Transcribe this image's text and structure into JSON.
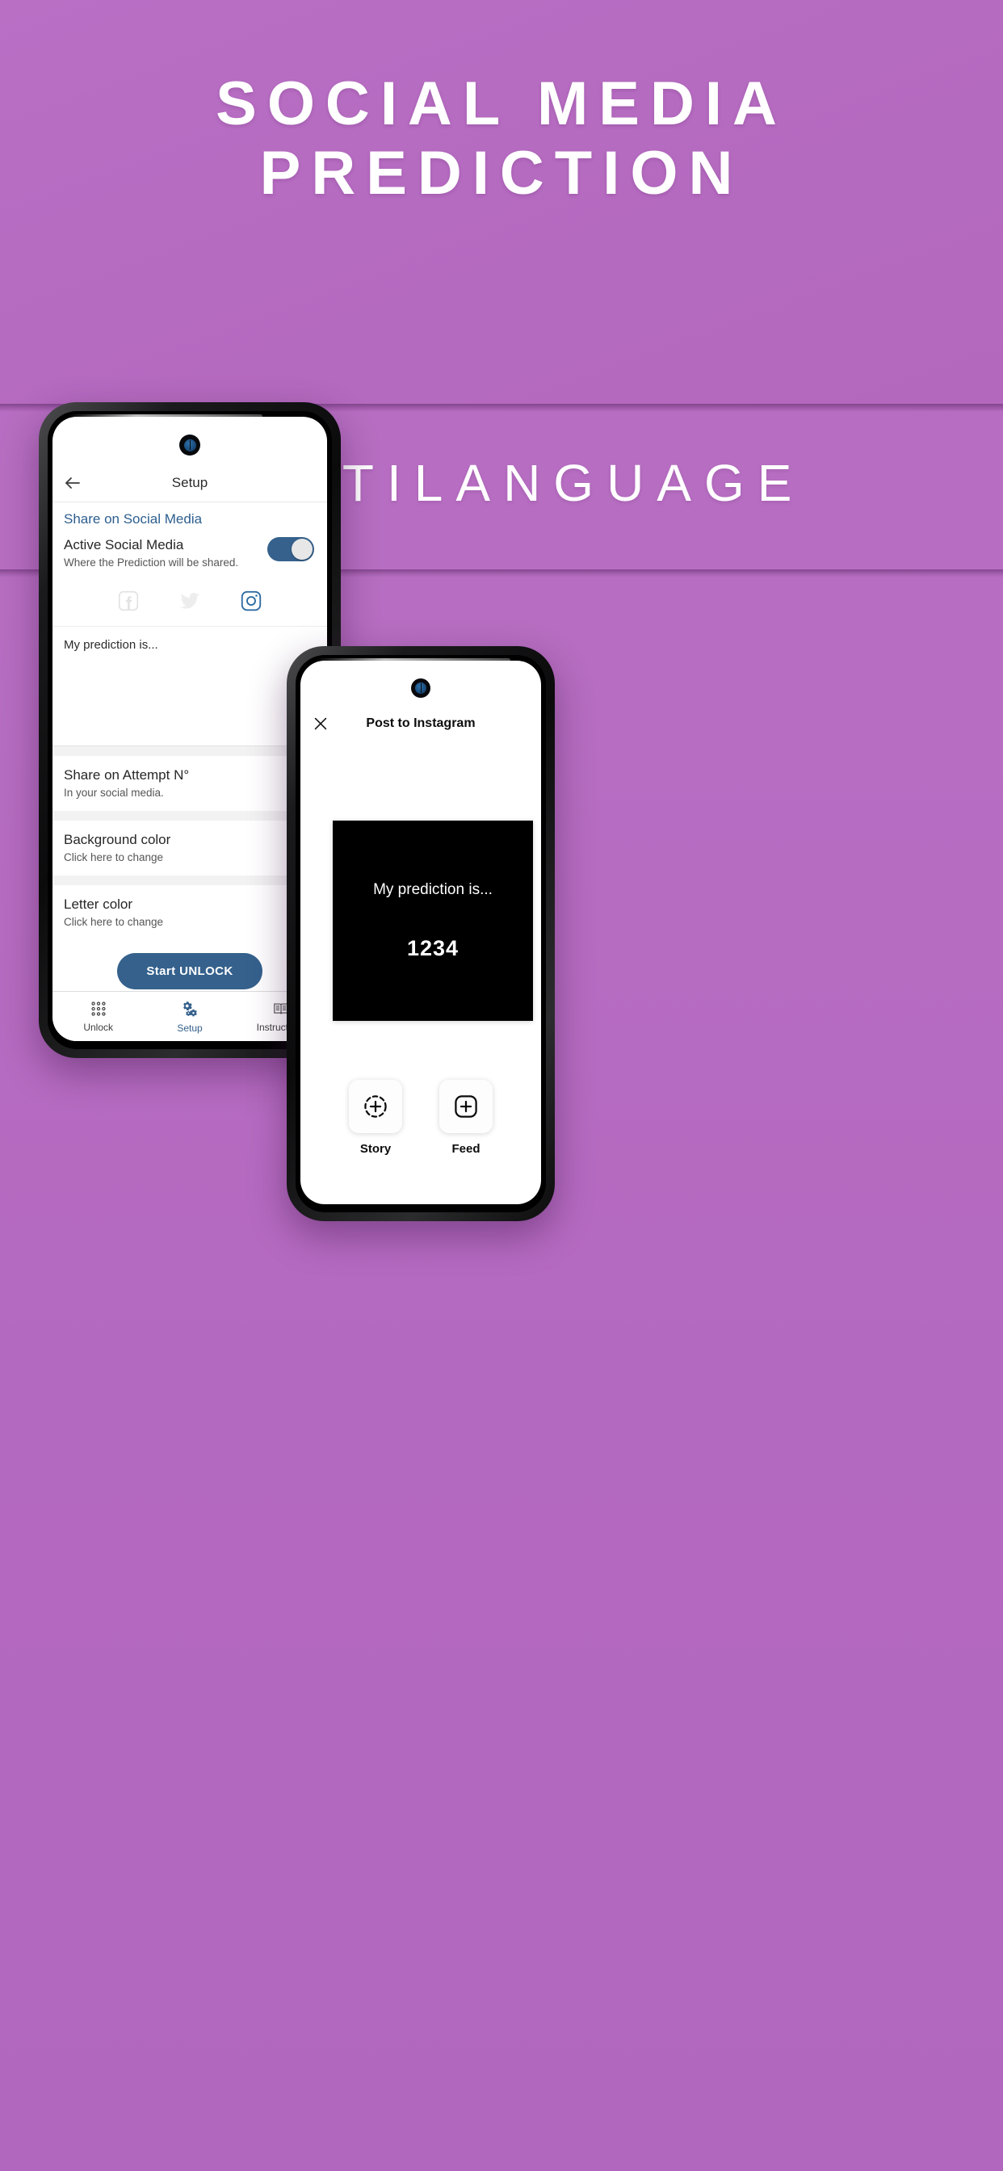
{
  "promo": {
    "headline_line1": "SOCIAL MEDIA",
    "headline_line2": "PREDICTION",
    "subtitle": "MULTILANGUAGE",
    "background_color": "#b66cc0",
    "accent_color": "#35618c"
  },
  "phone1": {
    "appbar": {
      "back_icon": "arrow-left-icon",
      "title": "Setup"
    },
    "section_header": "Share on Social Media",
    "active_row": {
      "title": "Active Social Media",
      "subtitle": "Where the Prediction will be shared.",
      "toggle_state": "on"
    },
    "social_icons": [
      {
        "name": "facebook-icon",
        "label": "Facebook",
        "selected": false
      },
      {
        "name": "twitter-icon",
        "label": "Twitter",
        "selected": false
      },
      {
        "name": "instagram-icon",
        "label": "Instagram",
        "selected": true
      }
    ],
    "prediction_text": "My prediction is...",
    "settings": [
      {
        "title": "Share on Attempt N°",
        "subtitle": "In your social media."
      },
      {
        "title": "Background color",
        "subtitle": "Click here to change"
      },
      {
        "title": "Letter color",
        "subtitle": "Click here to change"
      }
    ],
    "cta_label": "Start UNLOCK",
    "tabs": [
      {
        "label": "Unlock",
        "icon": "grid-dots-icon",
        "active": false
      },
      {
        "label": "Setup",
        "icon": "gears-icon",
        "active": true
      },
      {
        "label": "Instructions",
        "icon": "book-icon",
        "active": false
      }
    ]
  },
  "phone2": {
    "appbar": {
      "close_icon": "close-icon",
      "title": "Post to Instagram"
    },
    "preview": {
      "line": "My prediction is...",
      "number": "1234",
      "background_color": "#000000",
      "letter_color": "#ffffff"
    },
    "share_options": [
      {
        "label": "Story",
        "icon": "story-plus-icon"
      },
      {
        "label": "Feed",
        "icon": "feed-plus-icon"
      }
    ]
  }
}
